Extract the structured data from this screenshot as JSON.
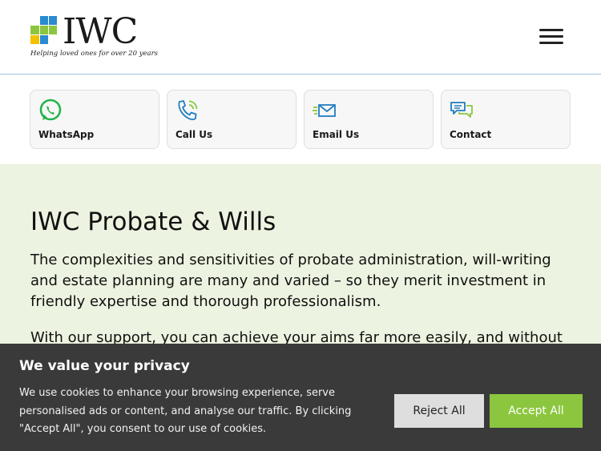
{
  "header": {
    "logo_text": "IWC",
    "logo_tagline": "Helping loved ones for over 20 years",
    "menu_icon": "hamburger-menu-icon"
  },
  "contact_options": [
    {
      "label": "WhatsApp",
      "icon": "whatsapp-icon"
    },
    {
      "label": "Call Us",
      "icon": "phone-icon"
    },
    {
      "label": "Email Us",
      "icon": "email-icon"
    },
    {
      "label": "Contact",
      "icon": "chat-bubbles-icon"
    }
  ],
  "main": {
    "title": "IWC Probate & Wills",
    "paragraph1": "The complexities and sensitivities of probate administration, will-writing and estate planning are many and varied – so they merit investment in friendly expertise and thorough professionalism.",
    "paragraph2": "With our support, you can achieve your aims far more easily, and without"
  },
  "cookie_banner": {
    "title": "We value your privacy",
    "text": "We use cookies to enhance your browsing experience, serve personalised ads or content, and analyse our traffic. By clicking \"Accept All\", you consent to our use of cookies.",
    "reject_label": "Reject All",
    "accept_label": "Accept All"
  },
  "colors": {
    "hero_background": "#ecf3e0",
    "accept_button": "#8cc63f",
    "cookie_background": "#3a3a3a",
    "whatsapp_green": "#25b34a",
    "icon_blue": "#1f7dc1",
    "logo_green": "#8cc63f",
    "logo_blue": "#2a8bd0"
  }
}
